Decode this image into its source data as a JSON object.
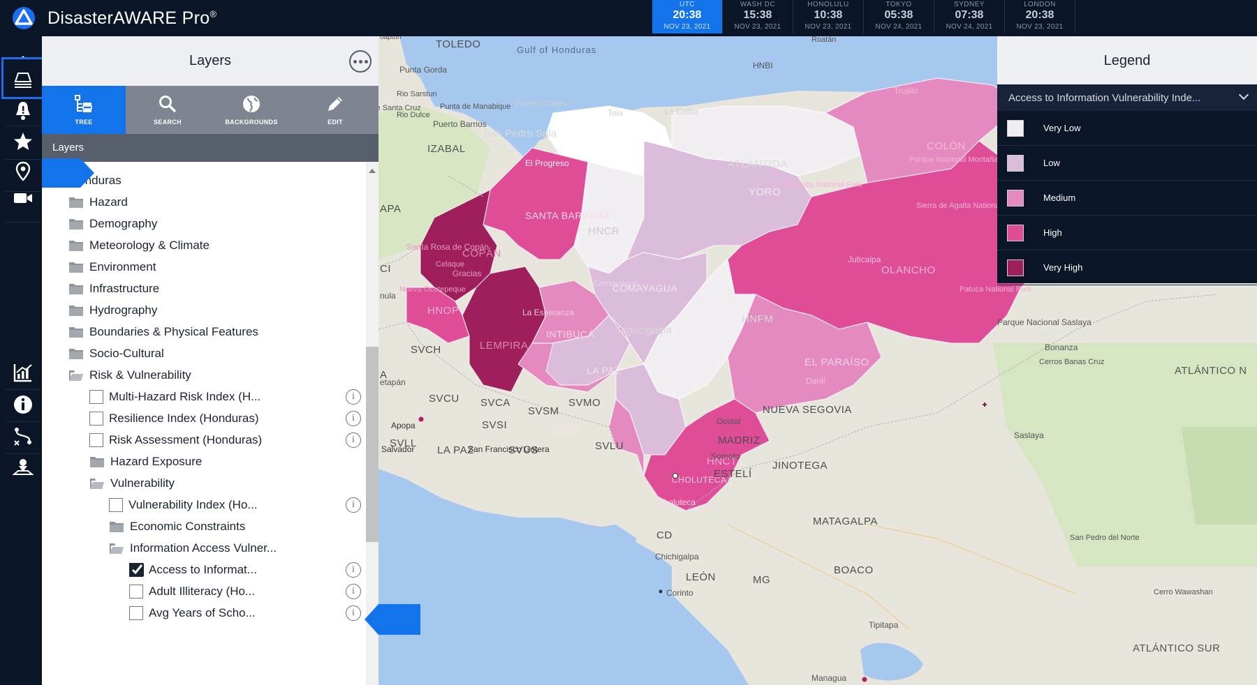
{
  "app": {
    "title": "DisasterAWARE Pro",
    "reg_mark": "®"
  },
  "clocks": [
    {
      "zone": "UTC",
      "time": "20:38",
      "date": "NOV 23, 2021"
    },
    {
      "zone": "WASH DC",
      "time": "15:38",
      "date": "NOV 23, 2021"
    },
    {
      "zone": "HONOLULU",
      "time": "10:38",
      "date": "NOV 23, 2021"
    },
    {
      "zone": "TOKYO",
      "time": "05:38",
      "date": "NOV 24, 2021"
    },
    {
      "zone": "SYDNEY",
      "time": "07:38",
      "date": "NOV 24, 2021"
    },
    {
      "zone": "LONDON",
      "time": "20:38",
      "date": "NOV 23, 2021"
    }
  ],
  "rail": [
    {
      "icon": "alert-diamond-icon"
    },
    {
      "icon": "layers-icon",
      "active": true
    },
    {
      "icon": "bell-icon"
    },
    {
      "icon": "star-icon"
    },
    {
      "icon": "location-pin-icon"
    },
    {
      "icon": "video-camera-icon"
    },
    {
      "icon": "chart-icon"
    },
    {
      "icon": "info-icon"
    },
    {
      "icon": "route-icon"
    },
    {
      "icon": "map-user-icon"
    }
  ],
  "panel": {
    "title": "Layers",
    "tabs": [
      "TREE",
      "SEARCH",
      "BACKGROUNDS",
      "EDIT"
    ],
    "section_label": "Layers",
    "tree": [
      {
        "label": "Honduras",
        "kind": "folder-open",
        "level": 0
      },
      {
        "label": "Hazard",
        "kind": "folder",
        "level": 1
      },
      {
        "label": "Demography",
        "kind": "folder",
        "level": 1
      },
      {
        "label": "Meteorology & Climate",
        "kind": "folder",
        "level": 1
      },
      {
        "label": "Environment",
        "kind": "folder",
        "level": 1
      },
      {
        "label": "Infrastructure",
        "kind": "folder",
        "level": 1
      },
      {
        "label": "Hydrography",
        "kind": "folder",
        "level": 1
      },
      {
        "label": "Boundaries & Physical Features",
        "kind": "folder",
        "level": 1
      },
      {
        "label": "Socio-Cultural",
        "kind": "folder",
        "level": 1
      },
      {
        "label": "Risk & Vulnerability",
        "kind": "folder-open",
        "level": 1
      },
      {
        "label": "Multi-Hazard Risk Index (H...",
        "kind": "checkbox",
        "level": 2,
        "checked": false,
        "info": true
      },
      {
        "label": "Resilience Index (Honduras)",
        "kind": "checkbox",
        "level": 2,
        "checked": false,
        "info": true
      },
      {
        "label": "Risk Assessment (Honduras)",
        "kind": "checkbox",
        "level": 2,
        "checked": false,
        "info": true
      },
      {
        "label": "Hazard Exposure",
        "kind": "folder",
        "level": 2
      },
      {
        "label": "Vulnerability",
        "kind": "folder-open",
        "level": 2
      },
      {
        "label": "Vulnerability Index (Ho...",
        "kind": "checkbox",
        "level": 3,
        "checked": false,
        "info": true
      },
      {
        "label": "Economic Constraints",
        "kind": "folder",
        "level": 3
      },
      {
        "label": "Information Access Vulner...",
        "kind": "folder-open",
        "level": 3
      },
      {
        "label": "Access to Informat...",
        "kind": "checkbox",
        "level": 4,
        "checked": true,
        "info": true
      },
      {
        "label": "Adult Illiteracy (Ho...",
        "kind": "checkbox",
        "level": 4,
        "checked": false,
        "info": true
      },
      {
        "label": "Avg Years of Scho...",
        "kind": "checkbox",
        "level": 4,
        "checked": false,
        "info": true
      }
    ]
  },
  "legend": {
    "title": "Legend",
    "layer": "Access to Information Vulnerability Inde...",
    "items": [
      {
        "label": "Very Low",
        "color": "#f2eff2"
      },
      {
        "label": "Low",
        "color": "#dcbcdb"
      },
      {
        "label": "Medium",
        "color": "#e58ac0"
      },
      {
        "label": "High",
        "color": "#df4c98"
      },
      {
        "label": "Very High",
        "color": "#9e1f5c"
      }
    ]
  },
  "map": {
    "labels_large": [
      "TOLEDO",
      "IZABAL",
      "SANTA BARBARA",
      "COPÁN",
      "LEMPIRA",
      "INTIBUCÁ",
      "LA PAZ",
      "COMAYAGUA",
      "HNFM",
      "EL PARAÍSO",
      "OLANCHO",
      "YORO",
      "ATLÁNTIDA",
      "COLÓN",
      "CHOLUTECA",
      "HNCT",
      "HNOP",
      "HNCR",
      "SVCH",
      "SVCU",
      "SVCA",
      "SVSM",
      "SVMO",
      "SVSI",
      "SVLL",
      "SVUS",
      "SVLU",
      "LA PAZ",
      "NUEVA SEGOVIA",
      "MADRIZ",
      "ESTELÍ",
      "JINOTEGA",
      "MATAGALPA",
      "BOACO",
      "CD",
      "LEÓN",
      "MG",
      "VALLE",
      "APA",
      "CI",
      "A"
    ],
    "labels_small": [
      "Gulf of Honduras",
      "Punta Gorda",
      "Sierra de Santa Cruz",
      "Rio Sarstun",
      "Rio Dulce",
      "Punta de Manabique",
      "Puerto Barrios",
      "Puerto Cortés",
      "San Pedro Sula",
      "La Ceiba",
      "Tela",
      "Trujillo",
      "El Progreso",
      "Santa Rosa de Copán",
      "Gracias",
      "Celaque",
      "Nueva Ocotepeque",
      "La Esperanza",
      "Comayagua",
      "Tegucigalpa",
      "Juticalpa",
      "Danlí",
      "Patuca National Park",
      "Sierra de Agalta National Park",
      "La Muralla National Park",
      "Parque Nacional Montaña de los Llanos",
      "Parque Nacional Saslaya",
      "Bonanza",
      "Cerros Banas Cruz",
      "Saslaya",
      "Ocotal",
      "Somoto",
      "San Francisco Gotera",
      "Apopa",
      "Salvador",
      "Chichigalpa",
      "Corinto",
      "Tipitapa",
      "Managua",
      "San Pedro del Norte",
      "Cerro Wawashan",
      "ATLÁNTICO N",
      "ATLÁNTICO SUR",
      "Roatán",
      "Choluteca",
      "nula",
      "etapán",
      "oaptun",
      "HNBI"
    ]
  }
}
